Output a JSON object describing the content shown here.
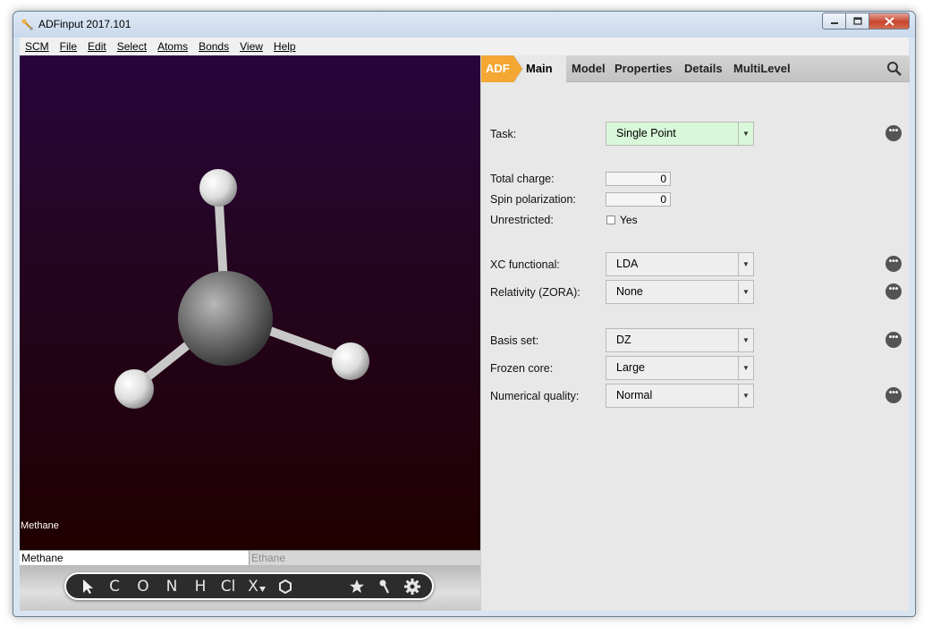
{
  "window": {
    "title": "ADFinput 2017.101"
  },
  "menu": {
    "items": [
      {
        "label": "SCM"
      },
      {
        "label": "File"
      },
      {
        "label": "Edit"
      },
      {
        "label": "Select"
      },
      {
        "label": "Atoms"
      },
      {
        "label": "Bonds"
      },
      {
        "label": "View"
      },
      {
        "label": "Help"
      }
    ]
  },
  "viewer": {
    "molecule_label": "Methane"
  },
  "molecule_tabs": {
    "active": "Methane",
    "inactive": "Ethane"
  },
  "tools": {
    "items": [
      "C",
      "O",
      "N",
      "H",
      "Cl",
      "X"
    ]
  },
  "panel": {
    "tabs": {
      "adf": "ADF",
      "main": "Main",
      "model": "Model",
      "properties": "Properties",
      "details": "Details",
      "multilevel": "MultiLevel"
    },
    "task": {
      "label": "Task:",
      "value": "Single Point"
    },
    "total_charge": {
      "label": "Total charge:",
      "value": "0"
    },
    "spin_polarization": {
      "label": "Spin polarization:",
      "value": "0"
    },
    "unrestricted": {
      "label": "Unrestricted:",
      "option": "Yes"
    },
    "xc_functional": {
      "label": "XC functional:",
      "value": "LDA"
    },
    "relativity": {
      "label": "Relativity (ZORA):",
      "value": "None"
    },
    "basis_set": {
      "label": "Basis set:",
      "value": "DZ"
    },
    "frozen_core": {
      "label": "Frozen core:",
      "value": "Large"
    },
    "numerical_quality": {
      "label": "Numerical quality:",
      "value": "Normal"
    }
  },
  "colors": {
    "accent": "#f4a733",
    "task_highlight": "#d9f8d9",
    "viewer_top": "#29053b",
    "viewer_bottom": "#200000"
  }
}
